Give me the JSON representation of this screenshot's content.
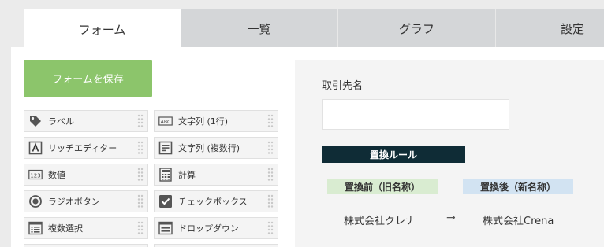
{
  "tabs": [
    {
      "label": "フォーム",
      "active": true
    },
    {
      "label": "一覧",
      "active": false
    },
    {
      "label": "グラフ",
      "active": false
    },
    {
      "label": "設定",
      "active": false
    }
  ],
  "save_button": "フォームを保存",
  "palette": {
    "left": [
      {
        "label": "ラベル",
        "icon": "tag-icon"
      },
      {
        "label": "リッチエディター",
        "icon": "rich-text-icon"
      },
      {
        "label": "数値",
        "icon": "number-icon"
      },
      {
        "label": "ラジオボタン",
        "icon": "radio-icon"
      },
      {
        "label": "複数選択",
        "icon": "multi-select-icon"
      }
    ],
    "right": [
      {
        "label": "文字列 (1行)",
        "icon": "single-line-text-icon"
      },
      {
        "label": "文字列 (複数行)",
        "icon": "multi-line-text-icon"
      },
      {
        "label": "計算",
        "icon": "calculator-icon"
      },
      {
        "label": "チェックボックス",
        "icon": "checkbox-icon"
      },
      {
        "label": "ドロップダウン",
        "icon": "dropdown-icon"
      }
    ]
  },
  "canvas": {
    "field_label": "取引先名",
    "field_value": "",
    "rule_title": "置換ルール",
    "before_header": "置換前（旧名称）",
    "after_header": "置換後（新名称）",
    "before_value": "株式会社クレナ",
    "arrow": "→",
    "after_value": "株式会社Crena"
  },
  "colors": {
    "save_button": "#8cc56b",
    "rule_header": "#0f2c36",
    "before_header": "#d9ecd1",
    "after_header": "#d2e3f2"
  }
}
